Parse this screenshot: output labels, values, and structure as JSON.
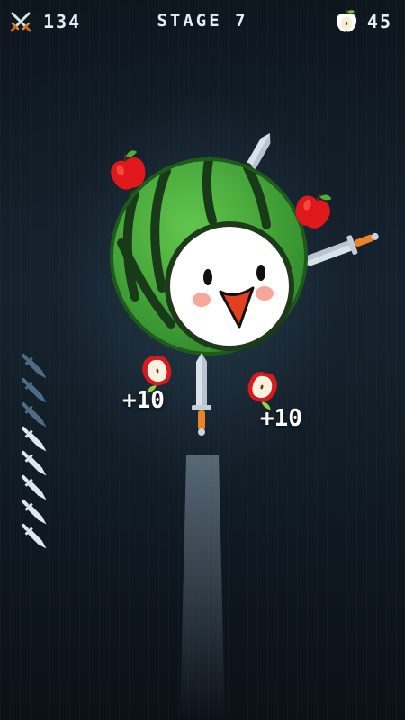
{
  "hud": {
    "knife_score": "134",
    "stage_label": "STAGE 7",
    "apple_count": "45",
    "icons": [
      "crossed-swords-icon",
      "apple-icon"
    ]
  },
  "popups": [
    "+10",
    "+10"
  ],
  "knife_counter": {
    "total": 8,
    "used": 3
  },
  "colors": {
    "watermelon": "#4caf3a",
    "knife_blade": "#d9e2ea",
    "knife_handle": "#e8832a",
    "apple": "#e31b1b"
  }
}
